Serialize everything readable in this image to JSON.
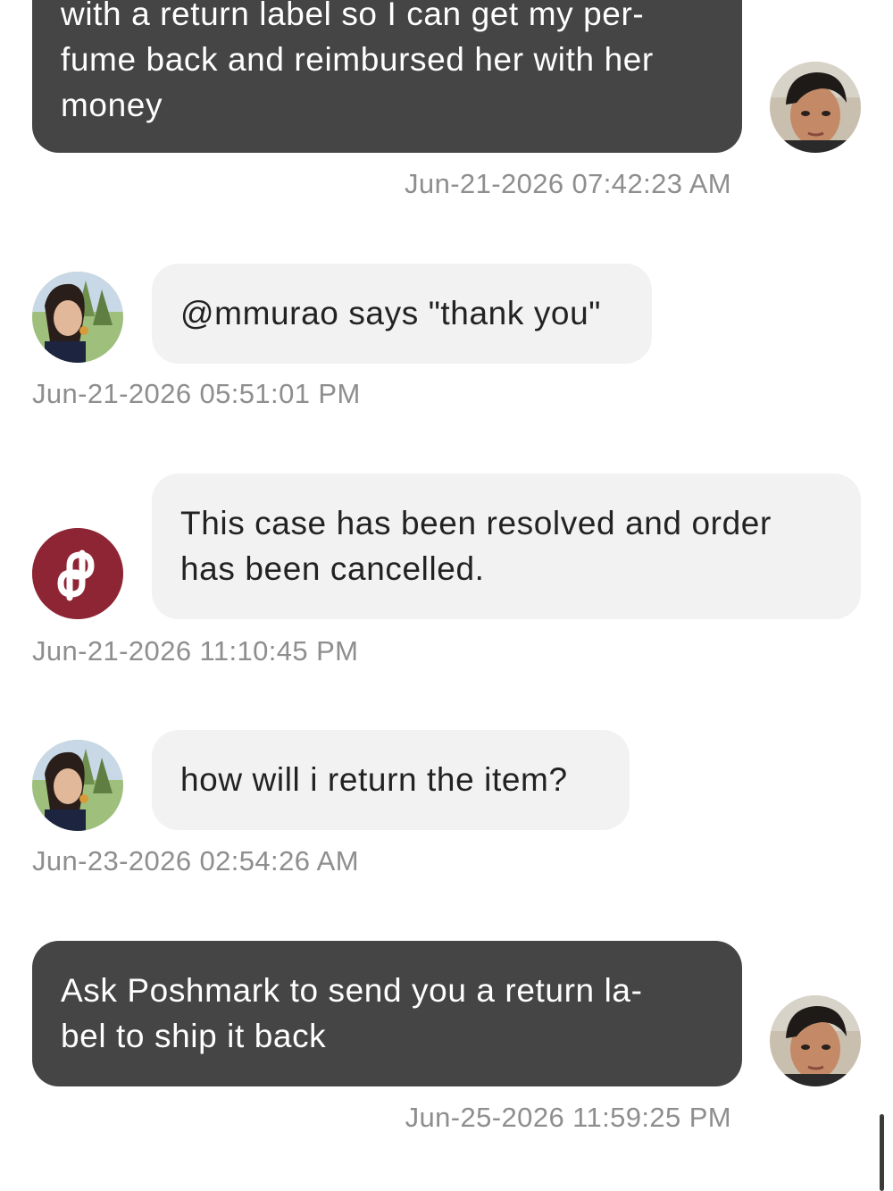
{
  "conversation": {
    "messages": [
      {
        "sender": "me",
        "lines": [
          "with a return label so I can get my per-",
          "fume back and reimbursed her with her",
          "money"
        ],
        "timestamp": "Jun-21-2026 07:42:23 AM"
      },
      {
        "sender": "buyer",
        "lines": [
          "@mmurao says \"thank you\""
        ],
        "timestamp": "Jun-21-2026 05:51:01 PM"
      },
      {
        "sender": "poshmark",
        "lines": [
          "This case has been resolved and order",
          "has been cancelled."
        ],
        "timestamp": "Jun-21-2026 11:10:45 PM"
      },
      {
        "sender": "buyer",
        "lines": [
          "how will i return the item?"
        ],
        "timestamp": "Jun-23-2026 02:54:26 AM"
      },
      {
        "sender": "me",
        "lines": [
          "Ask Poshmark to send you a return la-",
          "bel to ship it back"
        ],
        "timestamp": "Jun-25-2026 11:59:25 PM"
      }
    ]
  },
  "avatars": {
    "me": "user-avatar-photo",
    "buyer": "buyer-avatar-photo",
    "poshmark": "poshmark-logo-icon"
  },
  "colors": {
    "outgoing_bubble": "#454545",
    "incoming_bubble": "#f2f2f2",
    "timestamp_text": "#8e8e8e",
    "poshmark_brand": "#8e2535"
  }
}
